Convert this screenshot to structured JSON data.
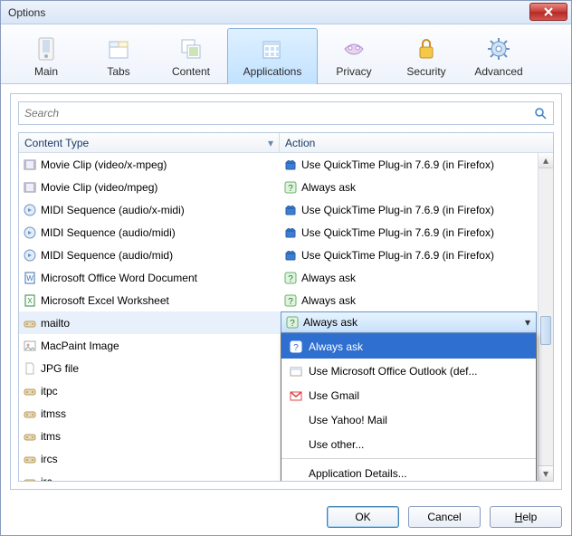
{
  "window": {
    "title": "Options"
  },
  "toolbar": {
    "tabs": [
      {
        "label": "Main"
      },
      {
        "label": "Tabs"
      },
      {
        "label": "Content"
      },
      {
        "label": "Applications"
      },
      {
        "label": "Privacy"
      },
      {
        "label": "Security"
      },
      {
        "label": "Advanced"
      }
    ]
  },
  "search": {
    "placeholder": "Search"
  },
  "columns": {
    "content_type": "Content Type",
    "action": "Action"
  },
  "rows": [
    {
      "ct": "Movie Clip (video/x-mpeg)",
      "ct_icon": "film",
      "ac": "Use QuickTime Plug-in 7.6.9 (in Firefox)",
      "ac_icon": "lego"
    },
    {
      "ct": "Movie Clip (video/mpeg)",
      "ct_icon": "film",
      "ac": "Always ask",
      "ac_icon": "ask"
    },
    {
      "ct": "MIDI Sequence (audio/x-midi)",
      "ct_icon": "audio",
      "ac": "Use QuickTime Plug-in 7.6.9 (in Firefox)",
      "ac_icon": "lego"
    },
    {
      "ct": "MIDI Sequence (audio/midi)",
      "ct_icon": "audio",
      "ac": "Use QuickTime Plug-in 7.6.9 (in Firefox)",
      "ac_icon": "lego"
    },
    {
      "ct": "MIDI Sequence (audio/mid)",
      "ct_icon": "audio",
      "ac": "Use QuickTime Plug-in 7.6.9 (in Firefox)",
      "ac_icon": "lego"
    },
    {
      "ct": "Microsoft Office Word Document",
      "ct_icon": "word",
      "ac": "Always ask",
      "ac_icon": "ask"
    },
    {
      "ct": "Microsoft Excel Worksheet",
      "ct_icon": "excel",
      "ac": "Always ask",
      "ac_icon": "ask"
    },
    {
      "ct": "mailto",
      "ct_icon": "proto",
      "ac": "Always ask",
      "ac_icon": "ask",
      "selected": true
    },
    {
      "ct": "MacPaint Image",
      "ct_icon": "img",
      "ac": "",
      "ac_icon": ""
    },
    {
      "ct": "JPG file",
      "ct_icon": "file",
      "ac": "",
      "ac_icon": ""
    },
    {
      "ct": "itpc",
      "ct_icon": "proto",
      "ac": "",
      "ac_icon": ""
    },
    {
      "ct": "itmss",
      "ct_icon": "proto",
      "ac": "",
      "ac_icon": ""
    },
    {
      "ct": "itms",
      "ct_icon": "proto",
      "ac": "",
      "ac_icon": ""
    },
    {
      "ct": "ircs",
      "ct_icon": "proto",
      "ac": "",
      "ac_icon": ""
    },
    {
      "ct": "irc",
      "ct_icon": "proto",
      "ac": "",
      "ac_icon": ""
    }
  ],
  "dropdown": {
    "selected": "Always ask",
    "items": [
      {
        "label": "Always ask",
        "icon": "ask",
        "highlight": true
      },
      {
        "label": "Use Microsoft Office Outlook (def...",
        "icon": "outlook"
      },
      {
        "label": "Use Gmail",
        "icon": "gmail"
      },
      {
        "label": "Use Yahoo! Mail",
        "icon": "",
        "indent": true
      },
      {
        "label": "Use other...",
        "icon": "",
        "indent": true
      },
      {
        "label": "Application Details...",
        "icon": "",
        "indent": true,
        "sep_before": true
      }
    ]
  },
  "buttons": {
    "ok": "OK",
    "cancel": "Cancel",
    "help": "Help"
  }
}
